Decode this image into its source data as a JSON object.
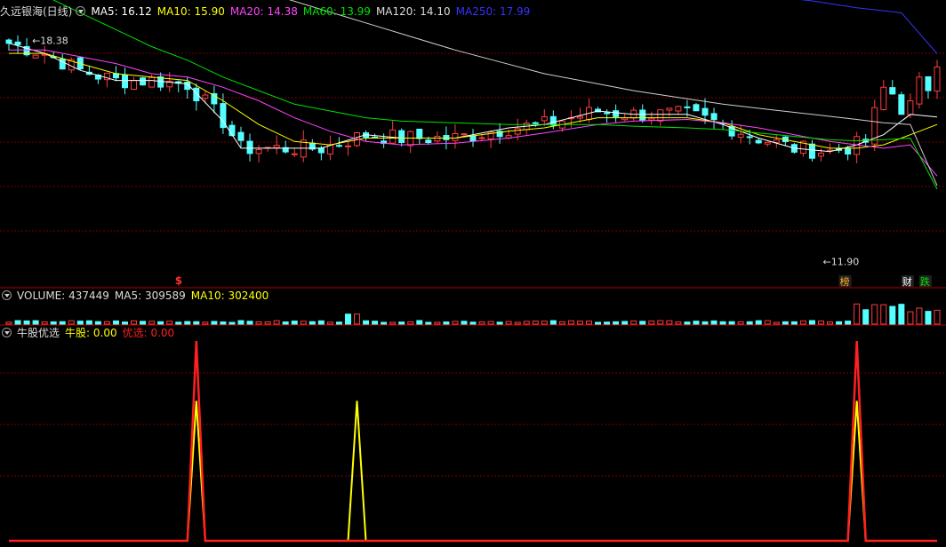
{
  "main_legend": {
    "title": "久远银海(日线)",
    "ma5": "MA5: 16.12",
    "ma10": "MA10: 15.90",
    "ma20": "MA20: 14.38",
    "ma60": "MA60: 13.99",
    "ma120": "MA120: 14.10",
    "ma250": "MA250: 17.99"
  },
  "volume_legend": {
    "label": "VOLUME: 437449",
    "ma5": "MA5: 309589",
    "ma10": "MA10: 302400"
  },
  "indicator_legend": {
    "label": "牛股优选",
    "bull": "牛股: 0.00",
    "pick": "优选: 0.00"
  },
  "annotations": {
    "high_price": "18.38",
    "low_price": "11.90",
    "buy_mark": "$",
    "mark_bang": "榜",
    "mark_cai": "财",
    "mark_die": "跌"
  },
  "colors": {
    "up": "#ff3c3c",
    "down": "#54ffff",
    "ma5": "#ffffff",
    "ma10": "#ffff00",
    "ma20": "#ff44ff",
    "ma60": "#00e000",
    "ma120": "#cfcfcf",
    "ma250": "#3333ff",
    "grid": "#7a0000",
    "bull_line": "#ffff00",
    "pick_line": "#ff2020"
  },
  "chart_data": [
    {
      "type": "candlestick",
      "x": "trading day index 0-104",
      "ylim": [
        11.5,
        19.0
      ],
      "series": [
        {
          "name": "MA5",
          "points": [
            [
              0,
              18.3
            ],
            [
              4,
              18.0
            ],
            [
              8,
              17.5
            ],
            [
              12,
              17.2
            ],
            [
              16,
              17.2
            ],
            [
              20,
              17.1
            ],
            [
              24,
              16.0
            ],
            [
              26,
              15.2
            ],
            [
              30,
              15.2
            ],
            [
              35,
              15.2
            ],
            [
              40,
              15.6
            ],
            [
              44,
              15.5
            ],
            [
              50,
              15.5
            ],
            [
              56,
              15.8
            ],
            [
              60,
              15.9
            ],
            [
              66,
              16.3
            ],
            [
              70,
              16.2
            ],
            [
              76,
              16.2
            ],
            [
              80,
              15.9
            ],
            [
              84,
              15.5
            ],
            [
              88,
              15.2
            ],
            [
              92,
              15.1
            ],
            [
              95,
              15.3
            ],
            [
              98,
              15.6
            ],
            [
              101,
              16.2
            ],
            [
              104,
              16.12
            ]
          ]
        },
        {
          "name": "MA10",
          "points": [
            [
              0,
              18.0
            ],
            [
              4,
              18.0
            ],
            [
              8,
              17.7
            ],
            [
              12,
              17.4
            ],
            [
              16,
              17.3
            ],
            [
              20,
              17.2
            ],
            [
              24,
              16.6
            ],
            [
              28,
              15.9
            ],
            [
              32,
              15.4
            ],
            [
              36,
              15.3
            ],
            [
              40,
              15.5
            ],
            [
              44,
              15.5
            ],
            [
              50,
              15.5
            ],
            [
              56,
              15.7
            ],
            [
              60,
              15.8
            ],
            [
              66,
              16.1
            ],
            [
              70,
              16.1
            ],
            [
              76,
              16.1
            ],
            [
              80,
              15.95
            ],
            [
              84,
              15.6
            ],
            [
              88,
              15.4
            ],
            [
              92,
              15.2
            ],
            [
              95,
              15.2
            ],
            [
              98,
              15.3
            ],
            [
              101,
              15.6
            ],
            [
              104,
              15.9
            ]
          ]
        },
        {
          "name": "MA20",
          "points": [
            [
              0,
              18.1
            ],
            [
              4,
              18.1
            ],
            [
              8,
              17.9
            ],
            [
              12,
              17.7
            ],
            [
              16,
              17.4
            ],
            [
              20,
              17.3
            ],
            [
              24,
              17.0
            ],
            [
              28,
              16.6
            ],
            [
              32,
              16.1
            ],
            [
              36,
              15.7
            ],
            [
              40,
              15.4
            ],
            [
              44,
              15.3
            ],
            [
              50,
              15.35
            ],
            [
              56,
              15.5
            ],
            [
              60,
              15.65
            ],
            [
              66,
              15.9
            ],
            [
              70,
              16.0
            ],
            [
              76,
              16.05
            ],
            [
              80,
              15.95
            ],
            [
              84,
              15.8
            ],
            [
              88,
              15.6
            ],
            [
              92,
              15.4
            ],
            [
              95,
              15.3
            ],
            [
              98,
              15.2
            ],
            [
              101,
              15.3
            ],
            [
              104,
              14.38
            ]
          ]
        },
        {
          "name": "MA60",
          "points": [
            [
              0,
              20.1
            ],
            [
              4,
              19.7
            ],
            [
              8,
              19.2
            ],
            [
              12,
              18.7
            ],
            [
              16,
              18.2
            ],
            [
              20,
              17.8
            ],
            [
              24,
              17.3
            ],
            [
              28,
              16.9
            ],
            [
              32,
              16.5
            ],
            [
              36,
              16.3
            ],
            [
              40,
              16.1
            ],
            [
              44,
              16.0
            ],
            [
              50,
              15.95
            ],
            [
              56,
              15.9
            ],
            [
              60,
              15.9
            ],
            [
              66,
              15.9
            ],
            [
              70,
              15.85
            ],
            [
              76,
              15.8
            ],
            [
              80,
              15.75
            ],
            [
              84,
              15.65
            ],
            [
              88,
              15.55
            ],
            [
              92,
              15.45
            ],
            [
              95,
              15.42
            ],
            [
              98,
              15.45
            ],
            [
              101,
              15.5
            ],
            [
              104,
              13.99
            ]
          ]
        },
        {
          "name": "MA120",
          "points": [
            [
              0,
              21.5
            ],
            [
              5,
              21.3
            ],
            [
              10,
              21.1
            ],
            [
              15,
              20.9
            ],
            [
              20,
              20.6
            ],
            [
              25,
              20.2
            ],
            [
              30,
              19.7
            ],
            [
              35,
              19.3
            ],
            [
              40,
              18.9
            ],
            [
              45,
              18.5
            ],
            [
              50,
              18.1
            ],
            [
              55,
              17.75
            ],
            [
              60,
              17.4
            ],
            [
              65,
              17.15
            ],
            [
              70,
              16.9
            ],
            [
              75,
              16.7
            ],
            [
              80,
              16.5
            ],
            [
              85,
              16.35
            ],
            [
              90,
              16.2
            ],
            [
              95,
              16.05
            ],
            [
              98,
              15.95
            ],
            [
              101,
              15.9
            ],
            [
              104,
              14.1
            ]
          ]
        },
        {
          "name": "MA250",
          "points": [
            [
              0,
              21.3
            ],
            [
              10,
              21.15
            ],
            [
              20,
              21.0
            ],
            [
              30,
              20.85
            ],
            [
              40,
              20.65
            ],
            [
              50,
              20.45
            ],
            [
              60,
              20.25
            ],
            [
              70,
              20.05
            ],
            [
              80,
              19.85
            ],
            [
              90,
              19.55
            ],
            [
              95,
              19.35
            ],
            [
              100,
              19.2
            ],
            [
              104,
              17.99
            ]
          ]
        }
      ]
    },
    {
      "type": "bar",
      "x": "trading day index 0-104",
      "last_value": 437449,
      "ma5": 309589,
      "ma10": 302400
    },
    {
      "type": "line",
      "x": "trading day index 0-104",
      "ylim": [
        0,
        100
      ],
      "series": [
        {
          "name": "牛股",
          "points": [
            [
              0,
              0
            ],
            [
              20,
              0
            ],
            [
              21,
              70
            ],
            [
              22,
              0
            ],
            [
              38,
              0
            ],
            [
              39,
              70
            ],
            [
              40,
              0
            ],
            [
              94,
              0
            ],
            [
              95,
              70
            ],
            [
              96,
              0
            ],
            [
              104,
              0
            ]
          ]
        },
        {
          "name": "优选",
          "points": [
            [
              0,
              0
            ],
            [
              20,
              0
            ],
            [
              21,
              100
            ],
            [
              22,
              0
            ],
            [
              94,
              0
            ],
            [
              95,
              100
            ],
            [
              96,
              0
            ],
            [
              104,
              0
            ]
          ]
        }
      ]
    }
  ]
}
